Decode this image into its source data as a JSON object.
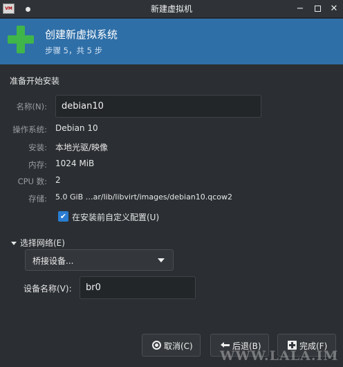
{
  "window": {
    "title": "新建虚拟机",
    "app_icon_text": "VM",
    "minimize": "−",
    "close": "✕"
  },
  "banner": {
    "title": "创建新虚拟系统",
    "step": "步骤 5，共 5 步",
    "icon": "plus-icon",
    "icon_color": "#3fb54a",
    "bg_color": "#2f6fa8"
  },
  "section_title": "准备开始安装",
  "form": {
    "name_label": "名称(N):",
    "name_value": "debian10",
    "os_label": "操作系统:",
    "os_value": "Debian 10",
    "install_label": "安装:",
    "install_value": "本地光驱/映像",
    "memory_label": "内存:",
    "memory_value": "1024 MiB",
    "cpu_label": "CPU 数:",
    "cpu_value": "2",
    "storage_label": "存储:",
    "storage_value": "5.0 GiB …ar/lib/libvirt/images/debian10.qcow2",
    "customize_label": "在安装前自定义配置(U)",
    "customize_checked": true
  },
  "network": {
    "expander_label": "选择网络(E)",
    "source_selected": "桥接设备...",
    "device_label": "设备名称(V):",
    "device_value": "br0"
  },
  "buttons": {
    "cancel": "取消(C)",
    "back": "后退(B)",
    "finish": "完成(F)"
  },
  "watermark": "WWW.LALA.IM"
}
